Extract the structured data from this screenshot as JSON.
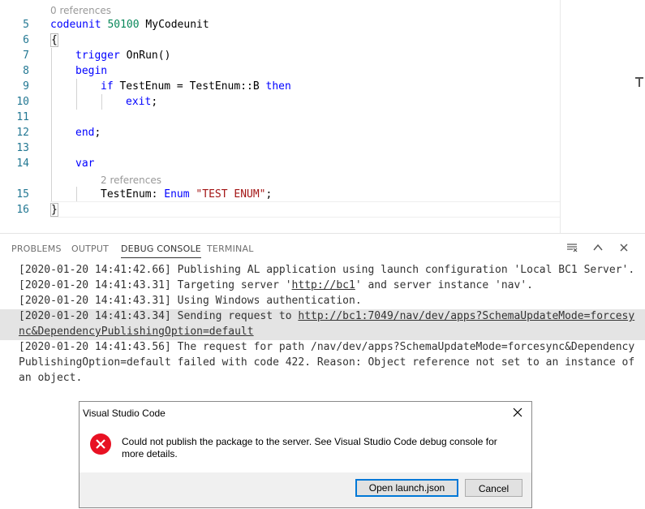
{
  "editor": {
    "codelens_top": "0 references",
    "codelens_var": "2 references",
    "line_numbers": [
      "5",
      "6",
      "7",
      "8",
      "9",
      "10",
      "11",
      "12",
      "13",
      "14",
      "15",
      "16"
    ],
    "lines": {
      "l5_kw": "codeunit",
      "l5_num": "50100",
      "l5_name": " MyCodeunit",
      "l6": "{",
      "l7_kw": "trigger",
      "l7_rest": " OnRun()",
      "l8_kw": "begin",
      "l9_kw_if": "if",
      "l9_mid": " TestEnum = TestEnum::B ",
      "l9_kw_then": "then",
      "l10_kw": "exit",
      "l10_rest": ";",
      "l12_kw": "end",
      "l12_rest": ";",
      "l14_kw": "var",
      "l15_name": "TestEnum: ",
      "l15_kw": "Enum",
      "l15_str": " \"TEST ENUM\"",
      "l15_end": ";",
      "l16": "}"
    }
  },
  "panel": {
    "tabs": [
      "PROBLEMS",
      "OUTPUT",
      "DEBUG CONSOLE",
      "TERMINAL"
    ],
    "active_tab": "DEBUG CONSOLE",
    "icons": [
      "clear-console-icon",
      "maximize-panel-icon",
      "close-panel-icon"
    ],
    "log": [
      {
        "text": "[2020-01-20 14:41:42.66] Publishing AL application using launch configuration 'Local BC1 Server'."
      },
      {
        "pre": "[2020-01-20 14:41:43.31] Targeting server '",
        "link": "http://bc1",
        "post": "' and server instance 'nav'."
      },
      {
        "text": "[2020-01-20 14:41:43.31] Using Windows authentication."
      },
      {
        "pre": "[2020-01-20 14:41:43.34] Sending request to ",
        "link": "http://bc1:7049/nav/dev/apps?SchemaUpdateMode=forcesync&DependencyPublishingOption=default",
        "post": ""
      },
      {
        "text": "[2020-01-20 14:41:43.56] The request for path /nav/dev/apps?SchemaUpdateMode=forcesync&DependencyPublishingOption=default failed with code 422. Reason: Object reference not set to an instance of an object."
      }
    ]
  },
  "dialog": {
    "title": "Visual Studio Code",
    "message": "Could not publish the package to the server. See Visual Studio Code debug console for more details.",
    "primary_button": "Open launch.json",
    "cancel_button": "Cancel",
    "error_color": "#e81123"
  }
}
